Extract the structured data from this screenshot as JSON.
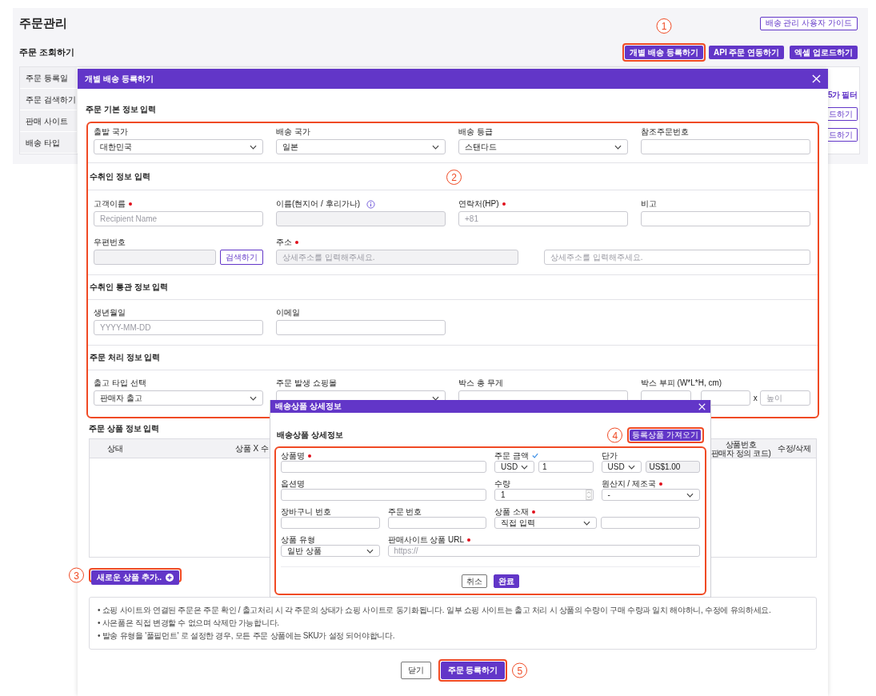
{
  "page": {
    "title": "주문관리",
    "guide_button": "배송 관리 사용자 가이드",
    "section_title": "주문 조회하기",
    "actions": [
      {
        "label": "개별 배송 등록하기",
        "highlighted": true,
        "callout": "1"
      },
      {
        "label": "API 주문 연동하기",
        "highlighted": false
      },
      {
        "label": "엑셀 업로드하기",
        "highlighted": false
      }
    ],
    "filters": [
      "주문 등록일",
      "주문 검색하기",
      "판매 사이트",
      "배송 타입"
    ],
    "partial_link": "5가 필터",
    "partial_buttons": [
      "드하기",
      "드하기"
    ]
  },
  "modal": {
    "title": "개별 배송 등록하기",
    "highlighted": true,
    "callout": "2",
    "sections": [
      {
        "title": "주문 기본 정보 입력",
        "fields": [
          {
            "label": "출발 국가",
            "kind": "select",
            "value": "대한민국"
          },
          {
            "label": "배송 국가",
            "kind": "select",
            "value": "일본"
          },
          {
            "label": "배송 등급",
            "kind": "select",
            "value": "스탠다드"
          },
          {
            "label": "참조주문번호",
            "kind": "input"
          }
        ]
      },
      {
        "title": "수취인 정보 입력",
        "fields": [
          {
            "label": "고객이름",
            "kind": "input",
            "required": true,
            "placeholder": "Recipient Name"
          },
          {
            "label": "이름(현지어 / 후리가나)",
            "kind": "input",
            "info": true,
            "disabled": true
          },
          {
            "label": "연락처(HP)",
            "kind": "input",
            "required": true,
            "placeholder": "+81"
          },
          {
            "label": "비고",
            "kind": "input"
          },
          {
            "label": "우편번호",
            "kind": "search",
            "disabled": true,
            "button": "검색하기"
          },
          {
            "label": "주소",
            "kind": "address",
            "required": true,
            "inputs": [
              {
                "placeholder": "상세주소를 입력해주세요.",
                "disabled": true
              },
              {
                "placeholder": "상세주소를 입력해주세요.",
                "disabled": false
              }
            ]
          }
        ]
      },
      {
        "title": "수취인 통관 정보 입력",
        "fields": [
          {
            "label": "생년월일",
            "kind": "input",
            "placeholder": "YYYY-MM-DD"
          },
          {
            "label": "이메일",
            "kind": "input"
          }
        ]
      },
      {
        "title": "주문 처리 정보 입력",
        "fields": [
          {
            "label": "출고 타입 선택",
            "kind": "select",
            "value": "판매자 출고"
          },
          {
            "label": "주문 발생 쇼핑몰",
            "kind": "select"
          },
          {
            "label": "박스 총 무게",
            "kind": "input"
          },
          {
            "label": "박스 부피 (W*L*H, cm)",
            "kind": "dims",
            "inputs": [
              {
                "disabled": false
              },
              {
                "disabled": false
              },
              {
                "prefix": "x",
                "placeholder": "높이",
                "disabled": false
              }
            ]
          }
        ]
      }
    ],
    "products": {
      "title": "주문 상품 정보 입력",
      "columns": [
        {
          "lines": [
            "상태"
          ]
        },
        {
          "lines": [
            "상품 X 수"
          ]
        },
        {
          "lines": [
            "상품번호",
            "판매자 정의 코드)"
          ]
        },
        {
          "lines": [
            "수정/삭제"
          ]
        }
      ]
    },
    "add_button": {
      "label": "새로운 상품 추가..",
      "highlighted": true,
      "callout": "3"
    },
    "notes": [
      "• 쇼핑 사이트와 연결된 주문은 주문 확인 / 출고처리 시 각 주문의 상태가 쇼핑 사이트로 동기화됩니다. 일부 쇼핑 사이트는 출고 처리 시 상품의 수량이 구매 수량과 일치 해야하니, 수정에 유의하세요.",
      "• 사은품은 직접 변경할 수 없으며 삭제만 가능합니다.",
      "• 발송 유형을 '풀필먼트' 로 설정한 경우, 모든 주문 상품에는 SKU가 설정 되어야합니다."
    ],
    "buttons": [
      {
        "label": "닫기",
        "kind": "secondary",
        "highlighted": false
      },
      {
        "label": "주문 등록하기",
        "kind": "primary",
        "highlighted": true,
        "callout": "5"
      }
    ]
  },
  "product_modal": {
    "title": "배송상품 상세정보",
    "subtitle": "배송상품 상세정보",
    "highlighted": true,
    "import_button": {
      "label": "등록상품 가져오기",
      "highlighted": true,
      "callout": "4"
    },
    "fields": [
      {
        "label": "상품명",
        "kind": "input",
        "required": true
      },
      {
        "label": "주문 금액",
        "kind": "money",
        "verified": true,
        "currency": "USD",
        "amount": "1"
      },
      {
        "label": "단가",
        "kind": "money",
        "currency": "USD",
        "amount": "US$1.00",
        "disabled": true
      },
      {
        "label": "옵션명",
        "kind": "input"
      },
      {
        "label": "수량",
        "kind": "number",
        "value": "1"
      },
      {
        "label": "원산지 / 제조국",
        "kind": "select",
        "required": true,
        "value": "-"
      },
      {
        "label": "장바구니 번호",
        "kind": "input"
      },
      {
        "label": "주문 번호",
        "kind": "input"
      },
      {
        "label": "상품 소재",
        "kind": "select_input",
        "required": true,
        "value": "직접 입력"
      },
      {
        "label": "상품 유형",
        "kind": "select",
        "value": "일반 상품"
      },
      {
        "label": "판매사이트 상품 URL",
        "kind": "input",
        "required": true,
        "placeholder": "https://"
      }
    ],
    "buttons": [
      {
        "label": "취소",
        "kind": "secondary"
      },
      {
        "label": "완료",
        "kind": "primary"
      }
    ]
  }
}
